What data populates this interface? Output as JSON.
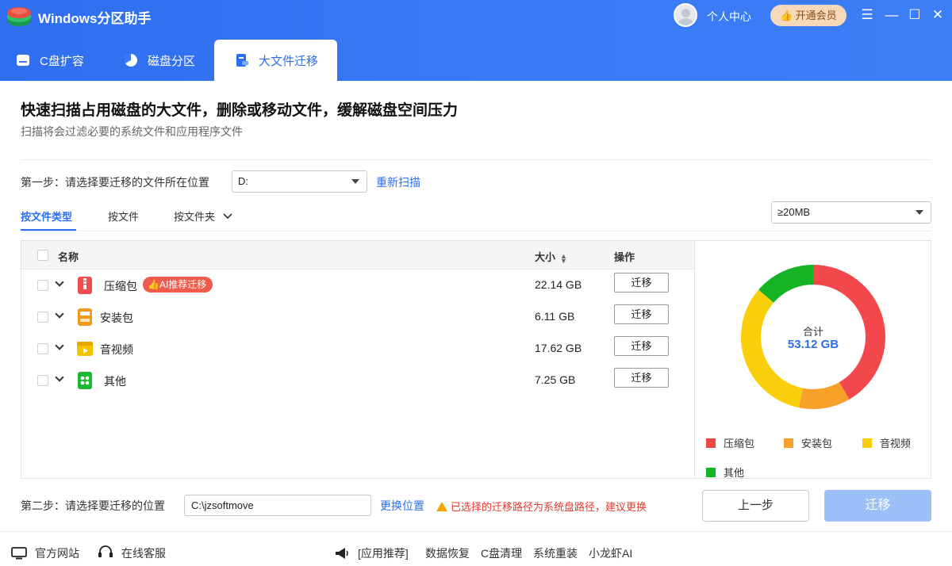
{
  "app": {
    "title": "Windows分区助手"
  },
  "header": {
    "user_label": "个人中心",
    "vip_label": "开通会员",
    "tabs": [
      {
        "label": "C盘扩容",
        "icon": "drive-icon"
      },
      {
        "label": "磁盘分区",
        "icon": "pie-icon"
      },
      {
        "label": "大文件迁移",
        "icon": "file-move-icon",
        "active": true
      }
    ]
  },
  "main": {
    "title": "快速扫描占用磁盘的大文件，删除或移动文件，缓解磁盘空间压力",
    "subtitle": "扫描将会过滤必要的系统文件和应用程序文件",
    "step1": {
      "label": "第一步：请选择要迁移的文件所在位置",
      "drive": "D:",
      "rescan": "重新扫描"
    },
    "subtabs": [
      {
        "label": "按文件类型",
        "active": true
      },
      {
        "label": "按文件"
      },
      {
        "label": "按文件夹"
      }
    ],
    "size_filter": "≥20MB",
    "table": {
      "headers": {
        "name": "名称",
        "size": "大小",
        "action": "操作"
      },
      "rows": [
        {
          "name": "压缩包",
          "size": "22.14 GB",
          "action": "迁移",
          "badge": "AI推荐迁移",
          "icon_color": "#f04e4e"
        },
        {
          "name": "安装包",
          "size": "6.11 GB",
          "action": "迁移",
          "icon_color": "#f39a1b"
        },
        {
          "name": "音视频",
          "size": "17.62 GB",
          "action": "迁移",
          "icon_color": "#f5c400"
        },
        {
          "name": "其他",
          "size": "7.25 GB",
          "action": "迁移",
          "icon_color": "#1db832"
        }
      ]
    },
    "chart": {
      "total_label": "合计",
      "total_value": "53.12 GB",
      "legend": [
        {
          "label": "压缩包",
          "color": "#f2474b"
        },
        {
          "label": "安装包",
          "color": "#f8a12a"
        },
        {
          "label": "音视频",
          "color": "#fbce0c"
        },
        {
          "label": "其他",
          "color": "#14b424"
        }
      ]
    },
    "step2": {
      "label": "第二步：请选择要迁移的位置",
      "path": "C:\\jzsoftmove",
      "change": "更换位置",
      "warning": "已选择的迁移路径为系统盘路径，建议更换"
    },
    "buttons": {
      "back": "上一步",
      "migrate": "迁移"
    }
  },
  "chart_data": {
    "type": "pie",
    "categories": [
      "压缩包",
      "安装包",
      "音视频",
      "其他"
    ],
    "values": [
      22.14,
      6.11,
      17.62,
      7.25
    ],
    "colors": [
      "#f2474b",
      "#f8a12a",
      "#fbce0c",
      "#14b424"
    ]
  },
  "footer": {
    "left": [
      {
        "label": "官方网站"
      },
      {
        "label": "在线客服"
      }
    ],
    "recommend_label": "[应用推荐]",
    "links": [
      "数据恢复",
      "C盘清理",
      "系统重装",
      "小龙虾AI"
    ]
  }
}
